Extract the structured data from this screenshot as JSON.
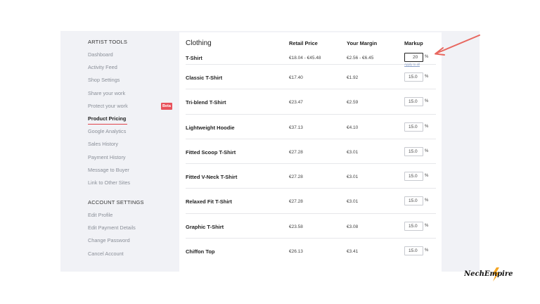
{
  "sidebar": {
    "artist_tools_heading": "ARTIST TOOLS",
    "artist_items": [
      {
        "label": "Dashboard"
      },
      {
        "label": "Activity Feed"
      },
      {
        "label": "Shop Settings"
      },
      {
        "label": "Share your work"
      },
      {
        "label": "Protect your work",
        "badge": "Beta"
      },
      {
        "label": "Product Pricing",
        "active": true
      },
      {
        "label": "Google Analytics"
      },
      {
        "label": "Sales History"
      },
      {
        "label": "Payment History"
      },
      {
        "label": "Message to Buyer"
      },
      {
        "label": "Link to Other Sites"
      }
    ],
    "account_heading": "ACCOUNT SETTINGS",
    "account_items": [
      {
        "label": "Edit Profile"
      },
      {
        "label": "Edit Payment Details"
      },
      {
        "label": "Change Password"
      },
      {
        "label": "Cancel Account"
      }
    ]
  },
  "table": {
    "section_title": "Clothing",
    "col_retail": "Retail Price",
    "col_margin": "Your Margin",
    "col_markup": "Markup",
    "apply_all": "Apply to all",
    "percent_sign": "%",
    "rows": [
      {
        "name": "T-Shirt",
        "retail": "€18.04 - €45.48",
        "margin": "€2.56 - €6.45",
        "markup": "20"
      },
      {
        "name": "Classic T-Shirt",
        "retail": "€17.40",
        "margin": "€1.92",
        "markup": "15.0"
      },
      {
        "name": "Tri-blend T-Shirt",
        "retail": "€23.47",
        "margin": "€2.59",
        "markup": "15.0"
      },
      {
        "name": "Lightweight Hoodie",
        "retail": "€37.13",
        "margin": "€4.10",
        "markup": "15.0"
      },
      {
        "name": "Fitted Scoop T-Shirt",
        "retail": "€27.28",
        "margin": "€3.01",
        "markup": "15.0"
      },
      {
        "name": "Fitted V-Neck T-Shirt",
        "retail": "€27.28",
        "margin": "€3.01",
        "markup": "15.0"
      },
      {
        "name": "Relaxed Fit T-Shirt",
        "retail": "€27.28",
        "margin": "€3.01",
        "markup": "15.0"
      },
      {
        "name": "Graphic T-Shirt",
        "retail": "€23.58",
        "margin": "€3.08",
        "markup": "15.0"
      },
      {
        "name": "Chiffon Top",
        "retail": "€26.13",
        "margin": "€3.41",
        "markup": "15.0"
      }
    ]
  },
  "watermark": {
    "text": "NechEmpire"
  },
  "colors": {
    "accent": "#e0434b",
    "arrow": "#e8675f",
    "panel_bg": "#f1f2f6",
    "lightning": "#f5a623"
  }
}
